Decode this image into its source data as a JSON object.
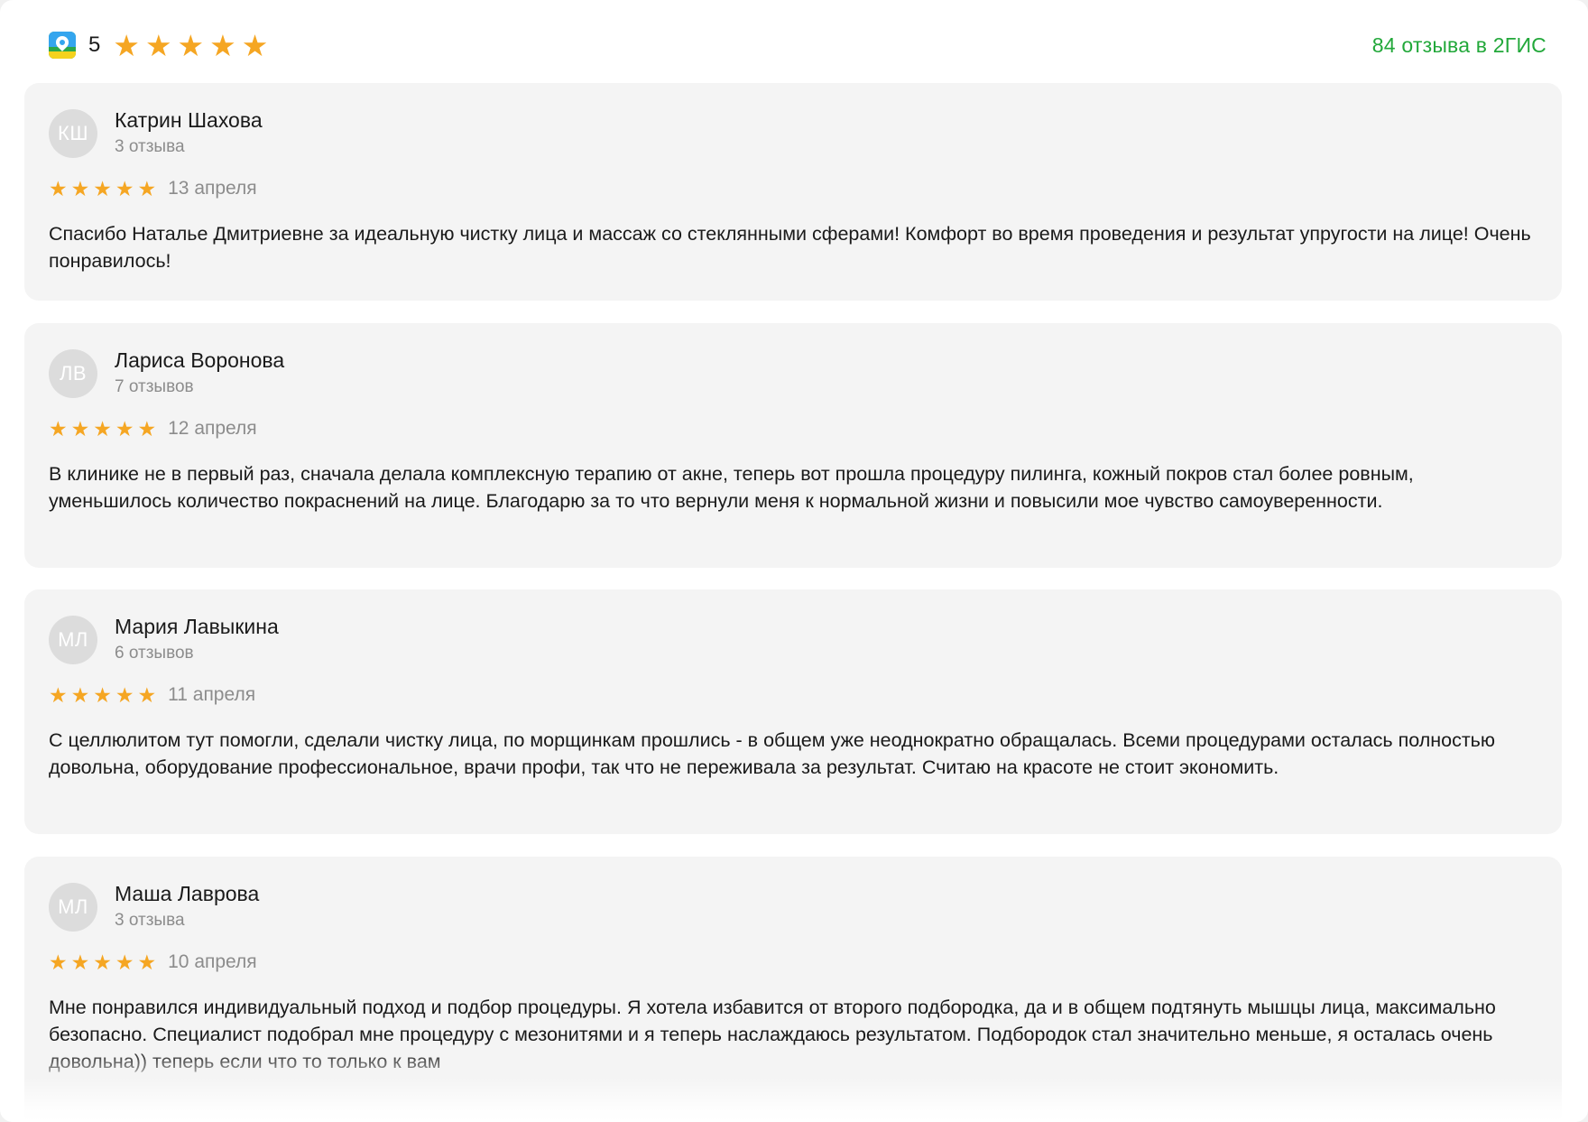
{
  "header": {
    "logo_icon": "2gis-logo-icon",
    "rating": "5",
    "star_count": 5,
    "total_reviews_link": "84 отзыва в 2ГИС"
  },
  "colors": {
    "star": "#f5a623",
    "link": "#22a83a",
    "card_bg": "#f4f4f4",
    "avatar_bg": "#dcdcdc"
  },
  "reviews": [
    {
      "initials": "КШ",
      "name": "Катрин Шахова",
      "reviews_count": "3 отзыва",
      "stars": 5,
      "date": "13 апреля",
      "text": "Спасибо Наталье Дмитриевне за идеальную чистку лица и массаж со стеклянными сферами! Комфорт во время проведения и результат упругости на лице! Очень понравилось!"
    },
    {
      "initials": "ЛВ",
      "name": "Лариса Воронова",
      "reviews_count": "7 отзывов",
      "stars": 5,
      "date": "12 апреля",
      "text": "В клинике не в первый раз, сначала делала комплексную терапию от акне, теперь вот прошла процедуру пилинга, кожный покров стал более ровным, уменьшилось количество покраснений на лице. Благодарю за то что вернули меня к нормальной жизни и повысили мое чувство самоуверенности."
    },
    {
      "initials": "МЛ",
      "name": "Мария Лавыкина",
      "reviews_count": "6 отзывов",
      "stars": 5,
      "date": "11 апреля",
      "text": "С целлюлитом тут помогли, сделали чистку лица, по морщинкам прошлись - в общем уже неоднократно обращалась. Всеми процедурами осталась полностью довольна, оборудование профессиональное, врачи профи, так что не переживала за результат. Считаю на красоте не стоит экономить."
    },
    {
      "initials": "МЛ",
      "name": "Маша Лаврова",
      "reviews_count": "3 отзыва",
      "stars": 5,
      "date": "10 апреля",
      "text": "Мне понравился индивидуальный подход и подбор процедуры. Я хотела избавится от второго подбородка, да и в общем подтянуть мышцы лица, максимально безопасно. Специалист подобрал мне процедуру с мезонитями и я теперь наслаждаюсь результатом. Подбородок стал значительно меньше, я осталась очень довольна)) теперь если что то только к вам"
    }
  ]
}
